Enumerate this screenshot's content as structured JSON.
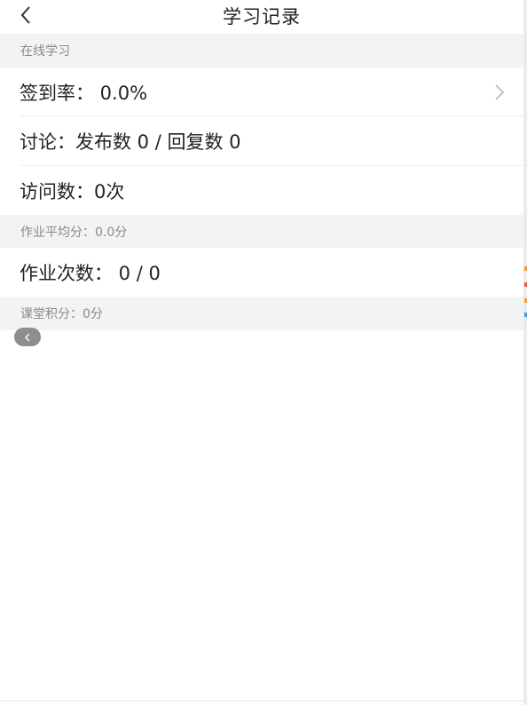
{
  "nav": {
    "title": "学习记录"
  },
  "sections": {
    "online": "在线学习",
    "homework_avg": "作业平均分：0.0分",
    "class_points": "课堂积分：0分"
  },
  "rows": {
    "checkin": "签到率： 0.0%",
    "discussion": "讨论：发布数 0 / 回复数 0",
    "visits": "访问数：0次",
    "homework_count": "作业次数： 0 / 0"
  },
  "icons": {
    "back": "chevron-left-icon",
    "row_arrow": "chevron-right-icon",
    "floating": "chevron-left-icon"
  },
  "colors": {
    "section_bg": "#f2f3f5",
    "section_text": "#8a8a8a",
    "text": "#222222",
    "floating_button": "#8e8e8e"
  }
}
